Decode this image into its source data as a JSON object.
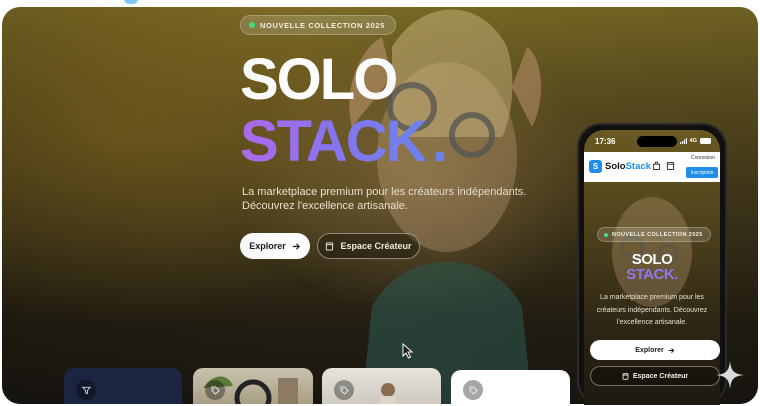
{
  "hero": {
    "badge": "NOUVELLE COLLECTION 2025",
    "title_line1": "SOLO",
    "title_line2": "STACK",
    "title_dot": ".",
    "subtitle": "La marketplace premium pour les créateurs indépendants. Découvrez l'excellence artisanale.",
    "primary_button": "Explorer",
    "secondary_button": "Espace Créateur"
  },
  "phone": {
    "time": "17:36",
    "network": "4G",
    "brand_solo": "Solo",
    "brand_stack": "Stack",
    "login_label": "Connexion",
    "signup_label": "Inscription",
    "badge": "NOUVELLE COLLECTION 2025",
    "title_line1": "SOLO",
    "title_line2": "STACK",
    "title_dot": ".",
    "subtitle": "La marketplace premium pour les créateurs indépendants. Découvrez l'excellence artisanale.",
    "primary_button": "Explorer",
    "secondary_button": "Espace Créateur"
  },
  "colors": {
    "accent_blue": "#1e8ee8",
    "gradient_purple": "#b46cf0",
    "gradient_blue": "#6e86f5",
    "badge_dot": "#4ade80"
  },
  "icons": {
    "card1": "filter-icon",
    "card2": "tag-icon",
    "card3": "tag-icon",
    "card4": "tag-icon"
  }
}
